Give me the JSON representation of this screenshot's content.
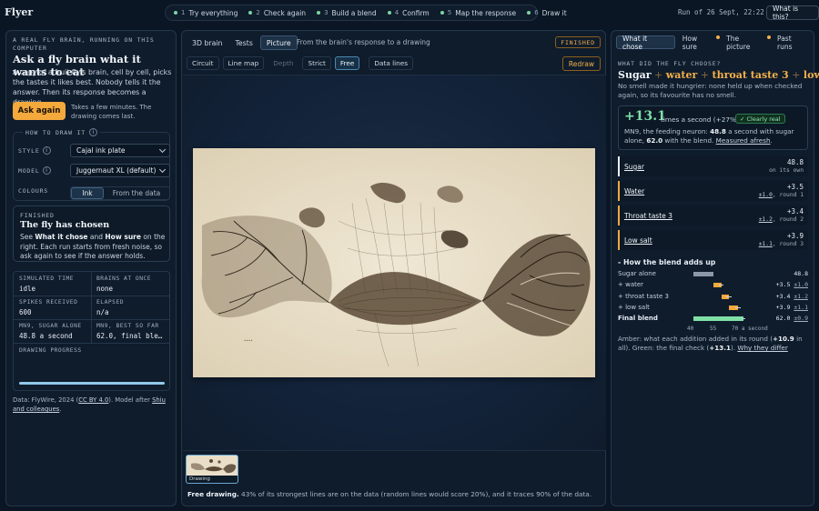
{
  "app": {
    "name": "Flyer"
  },
  "steps": [
    {
      "num": "1",
      "label": "Try everything"
    },
    {
      "num": "2",
      "label": "Check again"
    },
    {
      "num": "3",
      "label": "Build a blend"
    },
    {
      "num": "4",
      "label": "Confirm"
    },
    {
      "num": "5",
      "label": "Map the response"
    },
    {
      "num": "6",
      "label": "Draw it"
    }
  ],
  "header": {
    "run": "Run of 26 Sept, 22:22",
    "whatis": "What is this?"
  },
  "left": {
    "eyebrow": "A real fly brain, running on this computer",
    "title": "Ask a fly brain what it wants to eat",
    "desc": "A copy of a fruit fly's brain, cell by cell, picks the tastes it likes best. Nobody tells it the answer. Then its response becomes a drawing.",
    "ask_button": "Ask again",
    "ask_note": "Takes a few minutes. The drawing comes last.",
    "how_legend": "How to draw it",
    "style_label": "Style",
    "style_value": "Cajal ink plate",
    "model_label": "Model",
    "model_value": "Juggernaut XL (default)",
    "colours_label": "Colours",
    "colours_options": [
      "Ink",
      "From the data"
    ],
    "finished": {
      "eyebrow": "Finished",
      "title": "The fly has chosen",
      "text_1": "See ",
      "what": "What it chose",
      "text_2": " and ",
      "how": "How sure",
      "text_3": " on the right. Each run starts from fresh noise, so ask again to see if the answer holds."
    },
    "stats": {
      "sim_time_k": "Simulated time",
      "sim_time_v": "idle",
      "brains_k": "Brains at once",
      "brains_v": "none",
      "spikes_k": "Spikes received",
      "spikes_v": "600",
      "elapsed_k": "Elapsed",
      "elapsed_v": "n/a",
      "mn9_k": "MN9, sugar alone",
      "mn9_v": "48.8 a second",
      "best_k": "MN9, best so far",
      "best_v": "62.0, final ble…",
      "progress_k": "Drawing progress",
      "progress": 1.0
    },
    "credit_1": "Data: FlyWire, 2024 (",
    "credit_cc": "CC BY 4.0",
    "credit_2": "). Model after ",
    "credit_shiu": "Shiu and colleagues",
    "credit_3": "."
  },
  "center": {
    "tabs": [
      "3D brain",
      "Tests",
      "Picture"
    ],
    "active_tab": "Picture",
    "subtitle": "From the brain's response to a drawing",
    "badge": "Finished",
    "subtabs": [
      "Circuit",
      "Line map",
      "Depth",
      "Strict",
      "Free",
      "Data lines"
    ],
    "redraw": "Redraw",
    "thumb_caption": "Drawing",
    "foot_bold": "Free drawing.",
    "foot_text": " 43% of its strongest lines are on the data (random lines would score 20%), and it traces 90% of the data."
  },
  "right": {
    "tabs": [
      "What it chose",
      "How sure",
      "The picture",
      "Past runs"
    ],
    "question": "What did the fly choose?",
    "answer": [
      "Sugar",
      "water",
      "throat taste 3",
      "low salt"
    ],
    "note": "No smell made it hungrier: none held up when checked again, so its favourite has no smell.",
    "big_value": "+13.1",
    "big_unit": "times a second (+27%)",
    "clearly_real": "✓ Clearly real",
    "big_desc_1": "MN9, the feeding neuron: ",
    "big_desc_a": "48.8",
    "big_desc_2": " a second with sugar alone, ",
    "big_desc_b": "62.0",
    "big_desc_3": " with the blend. ",
    "big_desc_link": "Measured afresh",
    "big_desc_4": ".",
    "ingredients": [
      {
        "name": "Sugar",
        "value": "48.8",
        "sub": "on its own"
      },
      {
        "name": "Water",
        "value": "+3.5",
        "err": "±1.0",
        "round": ", round 1"
      },
      {
        "name": "Throat taste 3",
        "value": "+3.4",
        "err": "±1.2",
        "round": ", round 2"
      },
      {
        "name": "Low salt",
        "value": "+3.9",
        "err": "±1.1",
        "round": ", round 3"
      }
    ],
    "blend_heading": "-  How the blend adds up",
    "blend_rows": [
      {
        "name": "Sugar alone",
        "value": "48.8",
        "err": ""
      },
      {
        "name": "+ water",
        "value": "+3.5",
        "err": "±1.0"
      },
      {
        "name": "+ throat taste 3",
        "value": "+3.4",
        "err": "±1.2"
      },
      {
        "name": "+ low salt",
        "value": "+3.9",
        "err": "±1.1"
      },
      {
        "name": "Final blend",
        "value": "62.0",
        "err": "±0.9"
      }
    ],
    "axis": [
      "40",
      "55",
      "70 a second"
    ],
    "foot_1": "Amber: what each addition added in its round (",
    "foot_b": "+10.9",
    "foot_2": " in all). Green: the final check (",
    "foot_c": "+13.1",
    "foot_3": "). ",
    "foot_link": "Why they differ"
  },
  "colors": {
    "accent": "#f3a93c",
    "good": "#7fe0a6",
    "bg": "#0b1624"
  }
}
